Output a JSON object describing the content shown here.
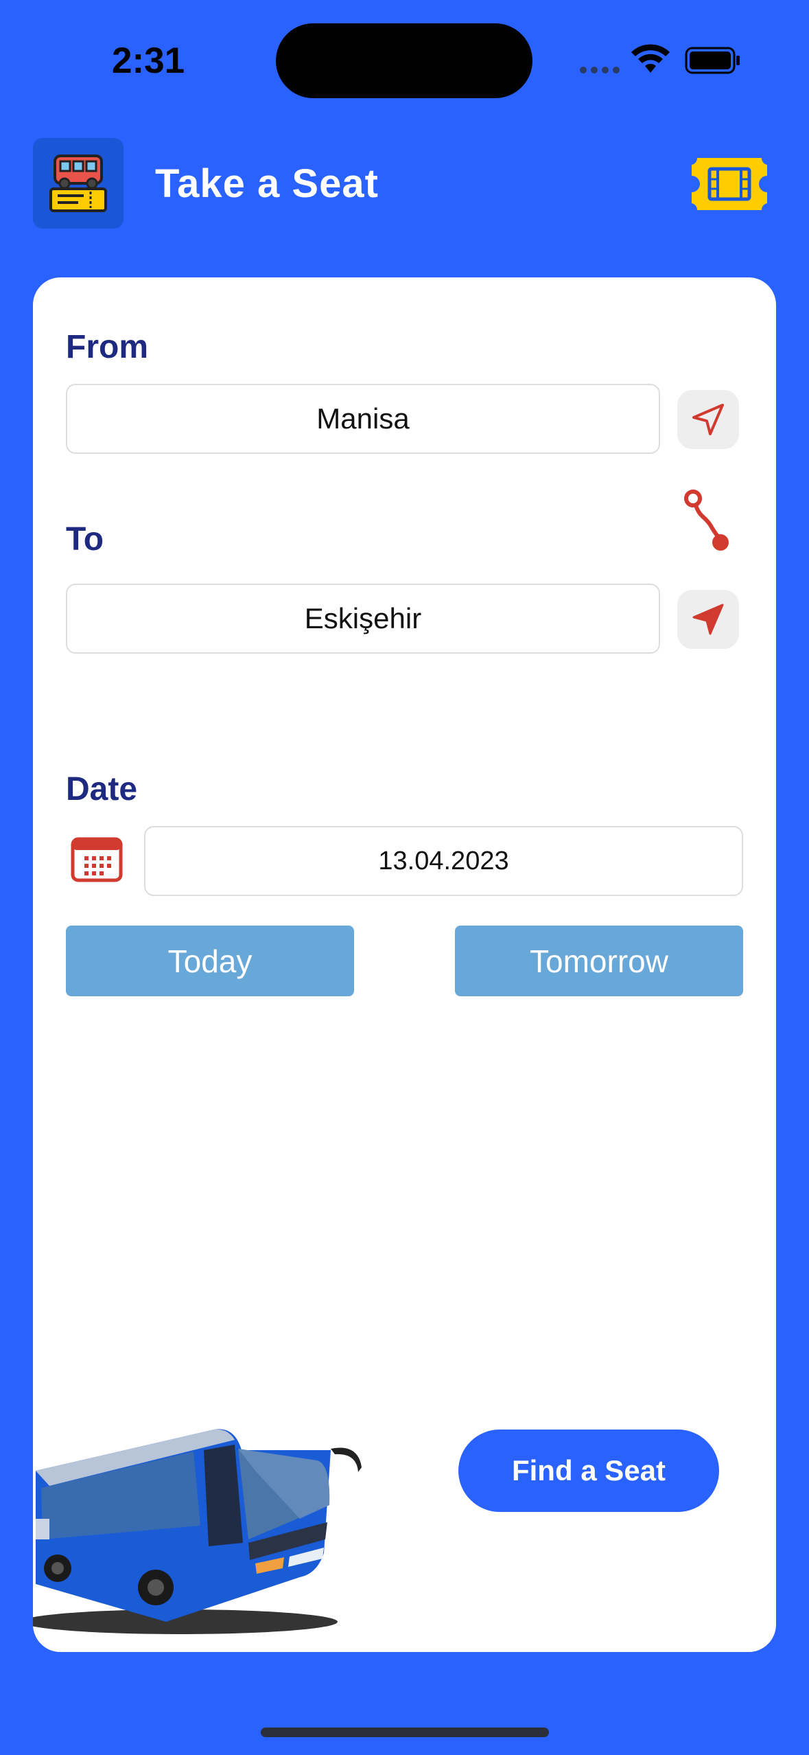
{
  "status_bar": {
    "time": "2:31"
  },
  "header": {
    "title": "Take a Seat"
  },
  "form": {
    "from_label": "From",
    "from_value": "Manisa",
    "to_label": "To",
    "to_value": "Eskişehir",
    "date_label": "Date",
    "date_value": "13.04.2023",
    "today_label": "Today",
    "tomorrow_label": "Tomorrow",
    "find_label": "Find a Seat"
  },
  "icons": {
    "app_logo": "bus-ticket-icon",
    "tickets": "ticket-icon",
    "from_location": "location-arrow-outline-icon",
    "to_location": "location-arrow-filled-icon",
    "route": "route-icon",
    "calendar": "calendar-icon"
  },
  "colors": {
    "background": "#2962FF",
    "label": "#1E2A80",
    "accent_red": "#D03A2F",
    "quick_button": "#68A8D8",
    "ticket_yellow": "#FFCC00"
  }
}
